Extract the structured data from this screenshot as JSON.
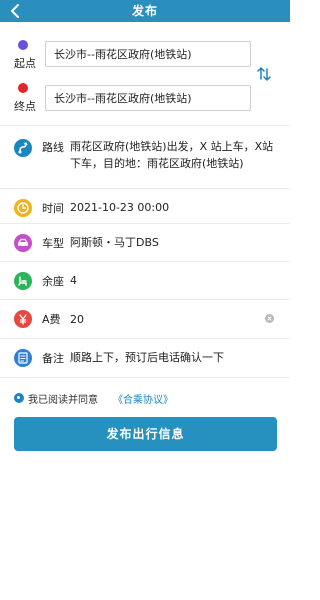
{
  "header": {
    "title": "发布"
  },
  "start": {
    "label": "起点",
    "value": "长沙市--雨花区政府(地铁站)",
    "dot_color": "#6a4ee0"
  },
  "end": {
    "label": "终点",
    "value": "长沙市--雨花区政府(地铁站)",
    "dot_color": "#e0262b"
  },
  "route": {
    "label": "路线",
    "value": "雨花区政府(地铁站)出发，X 站上车，X站下车，目的地：雨花区政府(地铁站)",
    "icon_color": "#1a86c0"
  },
  "time": {
    "label": "时间",
    "value": "2021-10-23 00:00",
    "icon_color": "#f2b01e"
  },
  "model": {
    "label": "车型",
    "value": "阿斯顿・马丁DBS",
    "icon_color": "#c44fc9"
  },
  "seats": {
    "label": "余座",
    "value": "4",
    "icon_color": "#2cb45a"
  },
  "fee": {
    "label": "A费",
    "value": "20",
    "icon_color": "#e8473e"
  },
  "note": {
    "label": "备注",
    "value": "顺路上下，预订后电话确认一下",
    "icon_color": "#2f7fd6"
  },
  "agreement": {
    "text": "我已阅读并同意",
    "link": "《合乘协议》"
  },
  "submit": {
    "label": "发布出行信息"
  },
  "colors": {
    "header": "#2a8fbd",
    "accent": "#1a86c0",
    "button": "#2690be"
  }
}
